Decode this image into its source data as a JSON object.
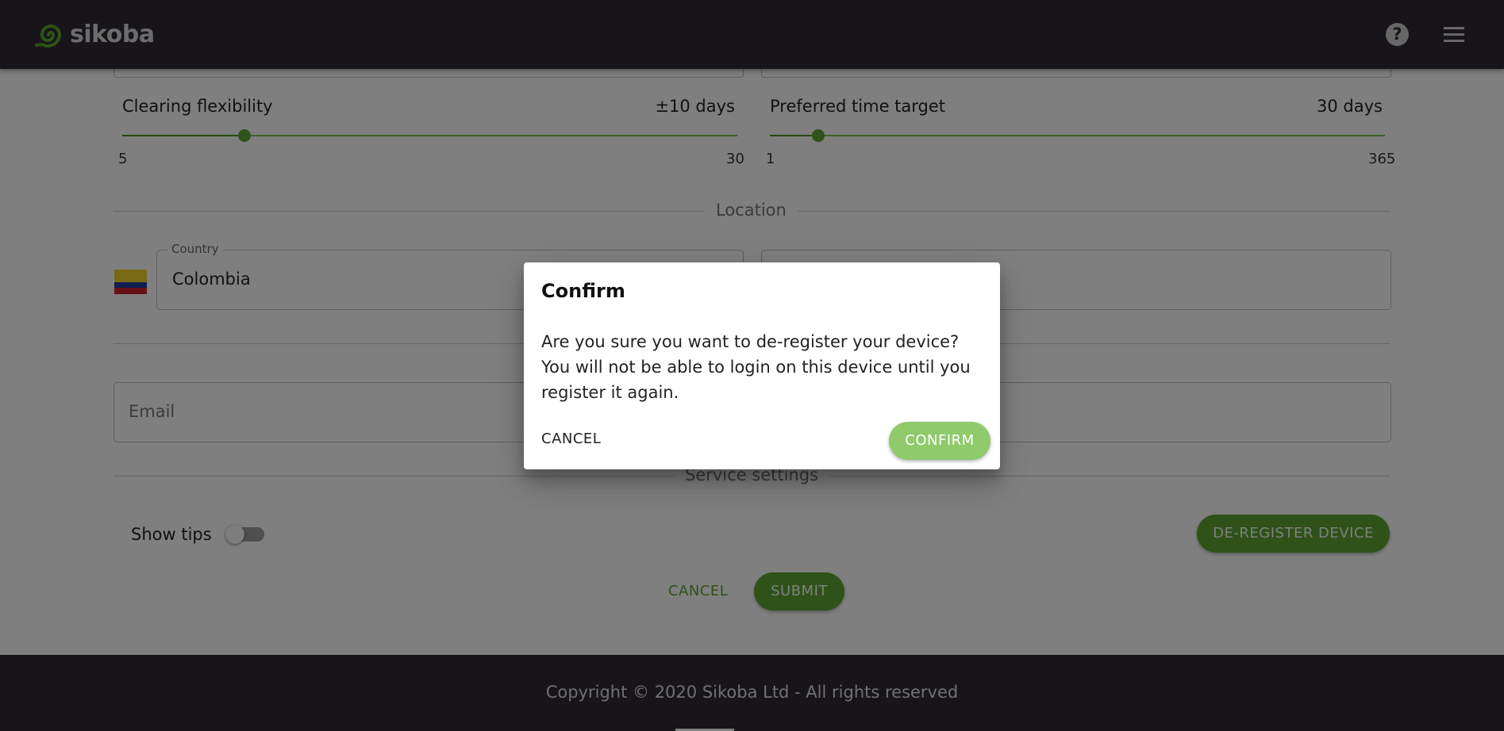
{
  "header": {
    "brand": "sikoba",
    "help_icon": "help-circle-icon",
    "menu_icon": "hamburger-menu-icon"
  },
  "clearing": {
    "label": "Clearing flexibility",
    "value": "±10 days",
    "min": "5",
    "max": "30",
    "current": 10
  },
  "time_target": {
    "label": "Preferred time target",
    "value": "30 days",
    "min": "1",
    "max": "365",
    "current": 30
  },
  "location": {
    "section": "Location",
    "country_label": "Country",
    "country_value": "Colombia"
  },
  "contact": {
    "email_placeholder": "Email"
  },
  "service": {
    "section": "Service settings",
    "show_tips_label": "Show tips",
    "show_tips_on": false,
    "deregister_label": "DE-REGISTER DEVICE"
  },
  "form_actions": {
    "cancel_label": "CANCEL",
    "submit_label": "SUBMIT"
  },
  "footer": {
    "copyright": "Copyright © 2020 Sikoba Ltd - All rights reserved"
  },
  "dialog": {
    "title": "Confirm",
    "body": "Are you sure you want to de-register your device? You will not be able to login on this device until you register it again.",
    "cancel_label": "CANCEL",
    "confirm_label": "CONFIRM"
  },
  "colors": {
    "brand_green": "#5da531",
    "header_bg": "#2e2a33",
    "flag_yellow": "#f2d32a",
    "flag_blue": "#1e3f9a",
    "flag_red": "#d0212f"
  }
}
